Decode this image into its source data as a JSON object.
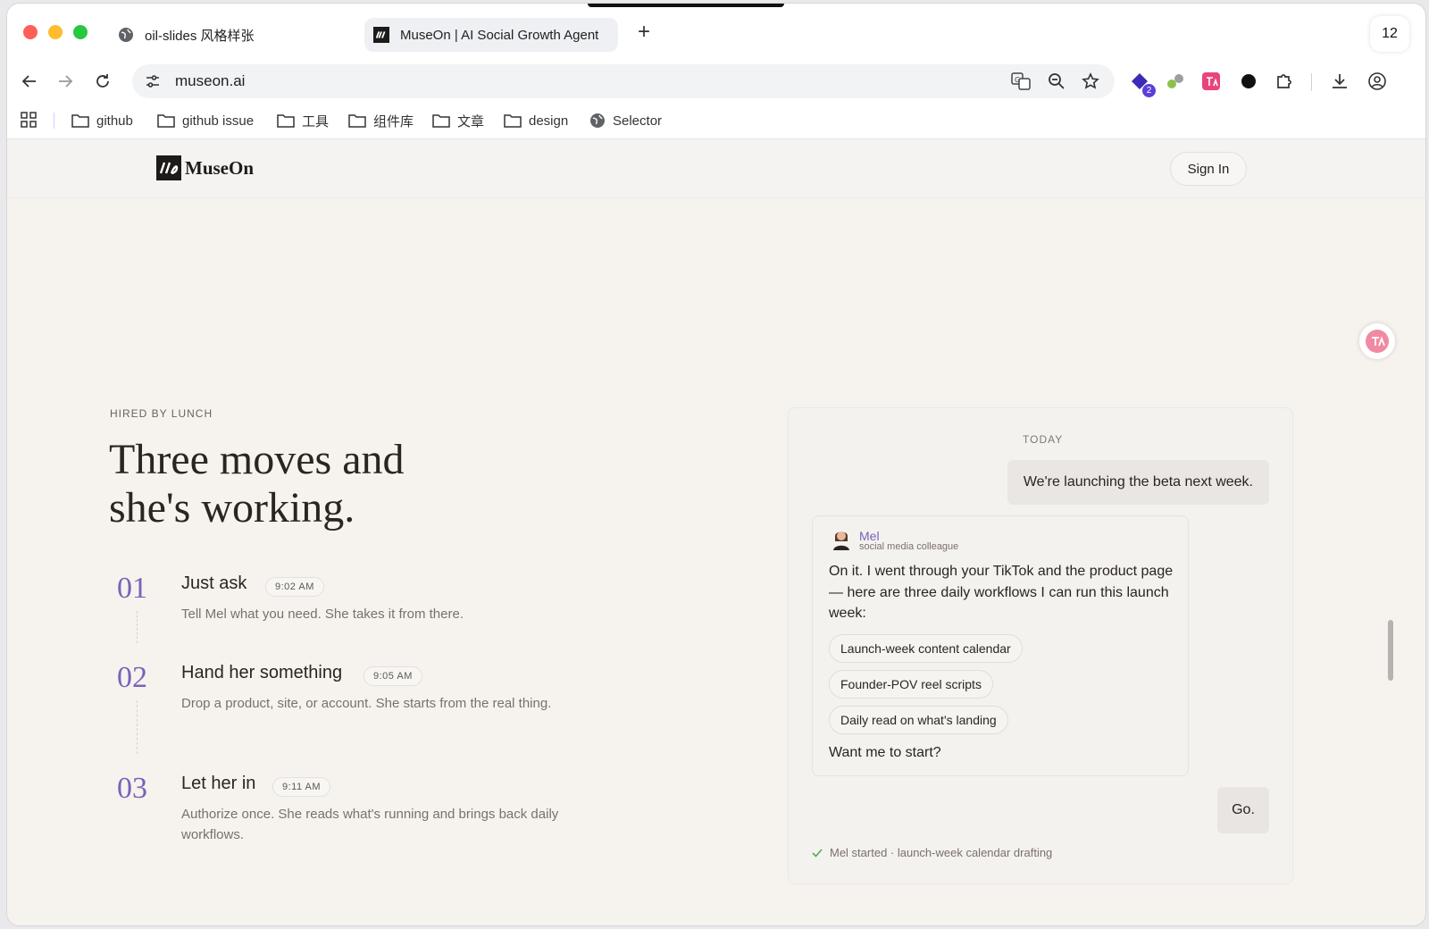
{
  "browser": {
    "tabs": [
      {
        "title": "oil-slides 风格样张"
      },
      {
        "title": "MuseOn | AI Social Growth Agent"
      }
    ],
    "new_tab": "+",
    "tab_count": "12",
    "url": "museon.ai",
    "extension_badge": "2",
    "bookmarks": [
      "github",
      "github issue",
      "工具",
      "组件库",
      "文章",
      "design",
      "Selector"
    ]
  },
  "site": {
    "logo_text": "MuseOn",
    "sign_in": "Sign In"
  },
  "hero": {
    "eyebrow": "HIRED BY LUNCH",
    "headline_line1": "Three moves and",
    "headline_line2": "she's working."
  },
  "steps": [
    {
      "num": "01",
      "title": "Just ask",
      "time": "9:02 AM",
      "desc": "Tell Mel what you need. She takes it from there."
    },
    {
      "num": "02",
      "title": "Hand her something",
      "time": "9:05 AM",
      "desc": "Drop a product, site, or account. She starts from the real thing."
    },
    {
      "num": "03",
      "title": "Let her in",
      "time": "9:11 AM",
      "desc": "Authorize once. She reads what's running and brings back daily workflows."
    }
  ],
  "chat": {
    "day_label": "TODAY",
    "user_message": "We're launching the beta next week.",
    "agent_name": "Mel",
    "agent_role": "social media colleague",
    "agent_message": "On it. I went through your TikTok and the product page — here are three daily workflows I can run this launch week:",
    "chips": [
      "Launch-week content calendar",
      "Founder-POV reel scripts",
      "Daily read on what's landing"
    ],
    "agent_ask": "Want me to start?",
    "reply": "Go.",
    "status": "Mel started · launch-week calendar drafting"
  },
  "colors": {
    "accent": "#7b62b7",
    "page_bg": "#f6f3ef",
    "text": "#2b2420"
  }
}
